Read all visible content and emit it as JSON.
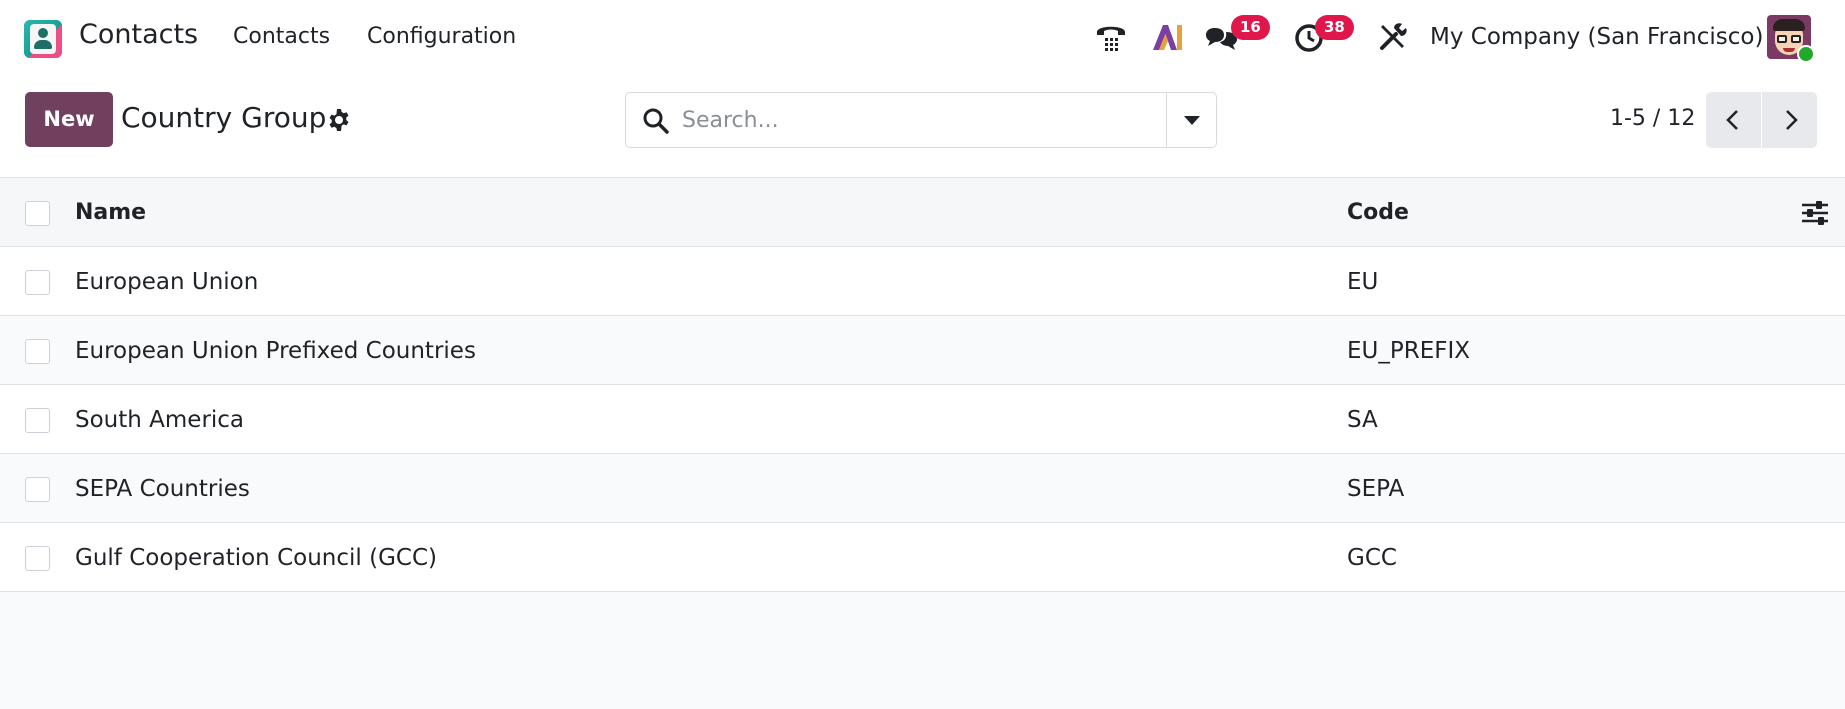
{
  "navbar": {
    "app_name": "Contacts",
    "menu": [
      "Contacts",
      "Configuration"
    ],
    "messages_badge": "16",
    "activities_badge": "38",
    "company": "My Company (San Francisco)"
  },
  "control_panel": {
    "new_label": "New",
    "title": "Country Group",
    "search_placeholder": "Search...",
    "pager": "1-5 / 12"
  },
  "list": {
    "headers": {
      "name": "Name",
      "code": "Code"
    },
    "rows": [
      {
        "name": "European Union",
        "code": "EU"
      },
      {
        "name": "European Union Prefixed Countries",
        "code": "EU_PREFIX"
      },
      {
        "name": "South America",
        "code": "SA"
      },
      {
        "name": "SEPA Countries",
        "code": "SEPA"
      },
      {
        "name": "Gulf Cooperation Council (GCC)",
        "code": "GCC"
      }
    ]
  },
  "colors": {
    "primary": "#71405f",
    "badge": "#e0174a",
    "online": "#22a82a"
  },
  "icons": [
    "contacts-app-icon",
    "phone-icon",
    "ai-icon",
    "chat-icon",
    "clock-icon",
    "tools-icon",
    "gear-icon",
    "search-icon",
    "caret-down-icon",
    "chevron-left-icon",
    "chevron-right-icon",
    "column-options-icon"
  ]
}
